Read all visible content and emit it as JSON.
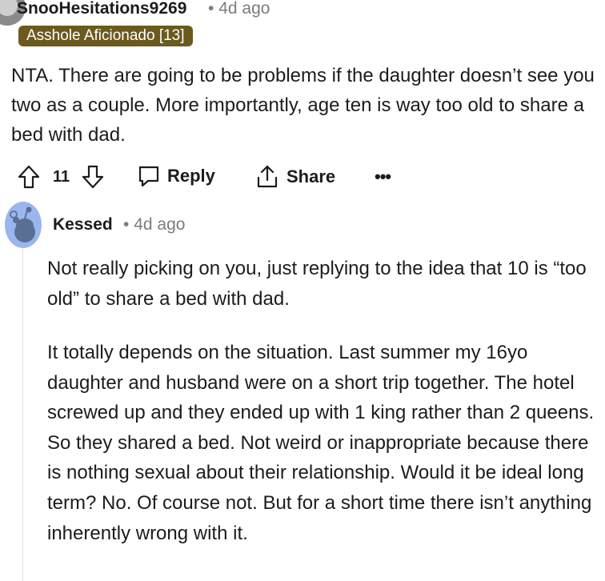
{
  "comment": {
    "author": "SnooHesitations9269",
    "timestamp": "4d ago",
    "flair": "Asshole Aficionado [13]",
    "body": "NTA. There are going to be problems if the daughter doesn’t see you two as a couple. More importantly, age ten is way too old to share a bed with dad.",
    "vote_count": "11",
    "actions": {
      "reply": "Reply",
      "share": "Share",
      "more": "•••"
    }
  },
  "reply": {
    "author": "Kessed",
    "timestamp": "4d ago",
    "paragraphs": [
      "Not really picking on you, just replying to the idea that 10 is “too old” to share a bed with dad.",
      "It totally depends on the situation. Last summer my 16yo daughter and husband were on a short trip together. The hotel screwed up and they ended up with 1 king rather than 2 queens. So they shared a bed. Not weird or inappropriate because there is nothing sexual about their relationship. Would it be ideal long term? No. Of course not. But for a short time there isn’t anything inherently wrong with it."
    ]
  },
  "icons": [
    "upvote-icon",
    "downvote-icon",
    "comment-icon",
    "share-icon",
    "snoo-avatar-icon"
  ],
  "colors": {
    "flair_bg": "#6b5a1e",
    "avatar_blue": "#9ab6ee",
    "meta_gray": "#7c7c7c"
  }
}
